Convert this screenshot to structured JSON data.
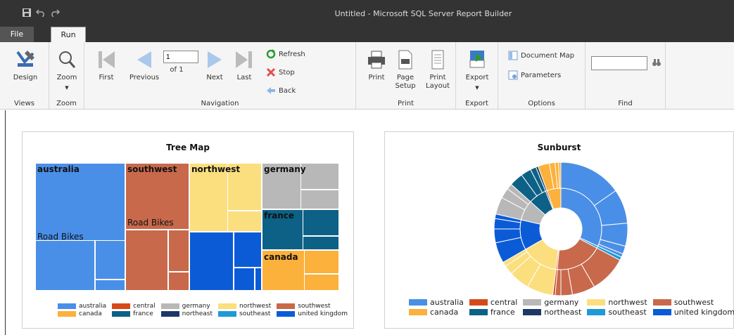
{
  "window": {
    "title": "Untitled - Microsoft SQL Server Report Builder"
  },
  "qat": {
    "icons": [
      "save-icon",
      "undo-icon",
      "redo-icon"
    ]
  },
  "tabs": [
    {
      "label": "File"
    },
    {
      "label": "Run"
    }
  ],
  "ribbon": {
    "views": {
      "group": "Views",
      "design": "Design"
    },
    "zoom": {
      "group": "Zoom",
      "zoom": "Zoom"
    },
    "navigation": {
      "group": "Navigation",
      "first": "First",
      "previous": "Previous",
      "page_value": "1",
      "of_label": "of 1",
      "next": "Next",
      "last": "Last",
      "refresh": "Refresh",
      "stop": "Stop",
      "back": "Back"
    },
    "print": {
      "group": "Print",
      "print": "Print",
      "page_setup_1": "Page",
      "page_setup_2": "Setup",
      "print_layout_1": "Print",
      "print_layout_2": "Layout"
    },
    "export": {
      "group": "Export",
      "export": "Export"
    },
    "options": {
      "group": "Options",
      "document_map": "Document Map",
      "parameters": "Parameters"
    },
    "find": {
      "group": "Find",
      "value": ""
    }
  },
  "colors": {
    "australia": "#4a8fe7",
    "central": "#d64a1a",
    "germany": "#b8b8b8",
    "northwest": "#fbdf7e",
    "southwest": "#c8694c",
    "canada": "#fbb13c",
    "france": "#0d6186",
    "northeast": "#1d3866",
    "southeast": "#1e9ad6",
    "united_kingdom": "#0b5bd7"
  },
  "treemap": {
    "title": "Tree Map",
    "labels": {
      "australia": "australia",
      "southwest": "southwest",
      "northwest": "northwest",
      "germany": "germany",
      "france": "france",
      "canada": "canada",
      "australia_sub": "Road Bikes",
      "southwest_sub": "Road Bikes"
    }
  },
  "sunburst": {
    "title": "Sunburst"
  },
  "legend": [
    {
      "key": "australia",
      "label": "australia"
    },
    {
      "key": "central",
      "label": "central"
    },
    {
      "key": "germany",
      "label": "germany"
    },
    {
      "key": "northwest",
      "label": "northwest"
    },
    {
      "key": "southwest",
      "label": "southwest"
    },
    {
      "key": "canada",
      "label": "canada"
    },
    {
      "key": "france",
      "label": "france"
    },
    {
      "key": "northeast",
      "label": "northeast"
    },
    {
      "key": "southeast",
      "label": "southeast"
    },
    {
      "key": "united_kingdom",
      "label": "united kingdom"
    }
  ]
}
